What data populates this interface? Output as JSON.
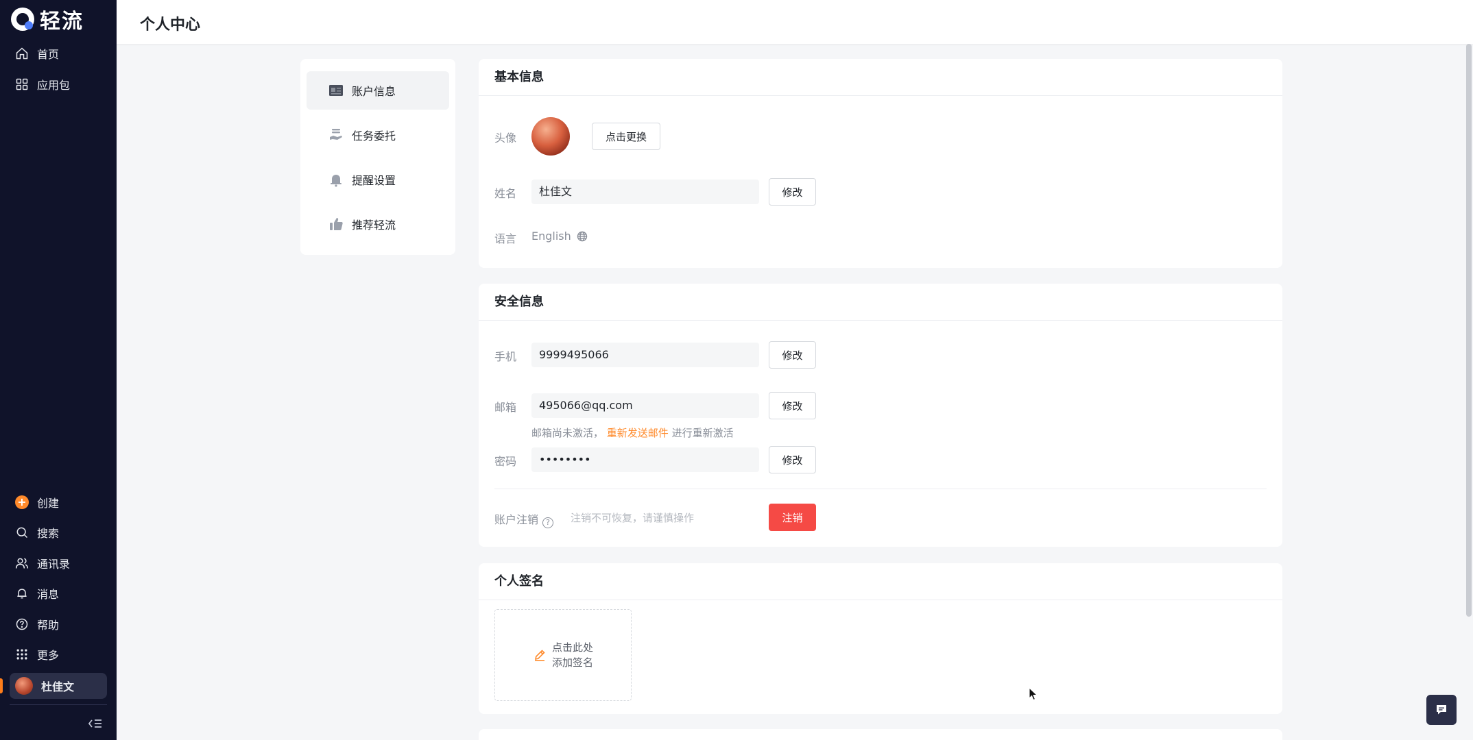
{
  "app": {
    "name": "轻流"
  },
  "sidebar": {
    "top_items": [
      {
        "label": "首页",
        "icon": "home-icon"
      },
      {
        "label": "应用包",
        "icon": "grid-icon"
      }
    ],
    "bottom_items": [
      {
        "label": "创建",
        "icon": "plus-circle-icon"
      },
      {
        "label": "搜索",
        "icon": "search-icon"
      },
      {
        "label": "通讯录",
        "icon": "contacts-icon"
      },
      {
        "label": "消息",
        "icon": "bell-icon"
      },
      {
        "label": "帮助",
        "icon": "help-icon"
      },
      {
        "label": "更多",
        "icon": "apps-icon"
      }
    ],
    "user": {
      "name": "杜佳文"
    }
  },
  "header": {
    "title": "个人中心"
  },
  "submenu": {
    "items": [
      {
        "label": "账户信息",
        "active": true
      },
      {
        "label": "任务委托",
        "active": false
      },
      {
        "label": "提醒设置",
        "active": false
      },
      {
        "label": "推荐轻流",
        "active": false
      }
    ]
  },
  "basic_info": {
    "title": "基本信息",
    "avatar_label": "头像",
    "change_avatar_label": "点击更换",
    "name_label": "姓名",
    "name_value": "杜佳文",
    "language_label": "语言",
    "language_value": "English",
    "edit_label": "修改"
  },
  "security_info": {
    "title": "安全信息",
    "phone_label": "手机",
    "phone_value": "9999495066",
    "email_label": "邮箱",
    "email_value": "495066@qq.com",
    "email_hint_prefix": "邮箱尚未激活，",
    "email_hint_link": "重新发送邮件",
    "email_hint_suffix": "进行重新激活",
    "password_label": "密码",
    "password_value": "••••••••",
    "edit_label": "修改",
    "deactivate_label": "账户注销",
    "deactivate_hint": "注销不可恢复，请谨慎操作",
    "deactivate_button": "注销"
  },
  "signature": {
    "title": "个人签名",
    "add_line1": "点击此处",
    "add_line2": "添加签名"
  },
  "colors": {
    "sidebar_bg": "#10132a",
    "accent_orange": "#ff8a2b",
    "danger_red": "#f54a45",
    "page_bg": "#f5f6f8"
  }
}
